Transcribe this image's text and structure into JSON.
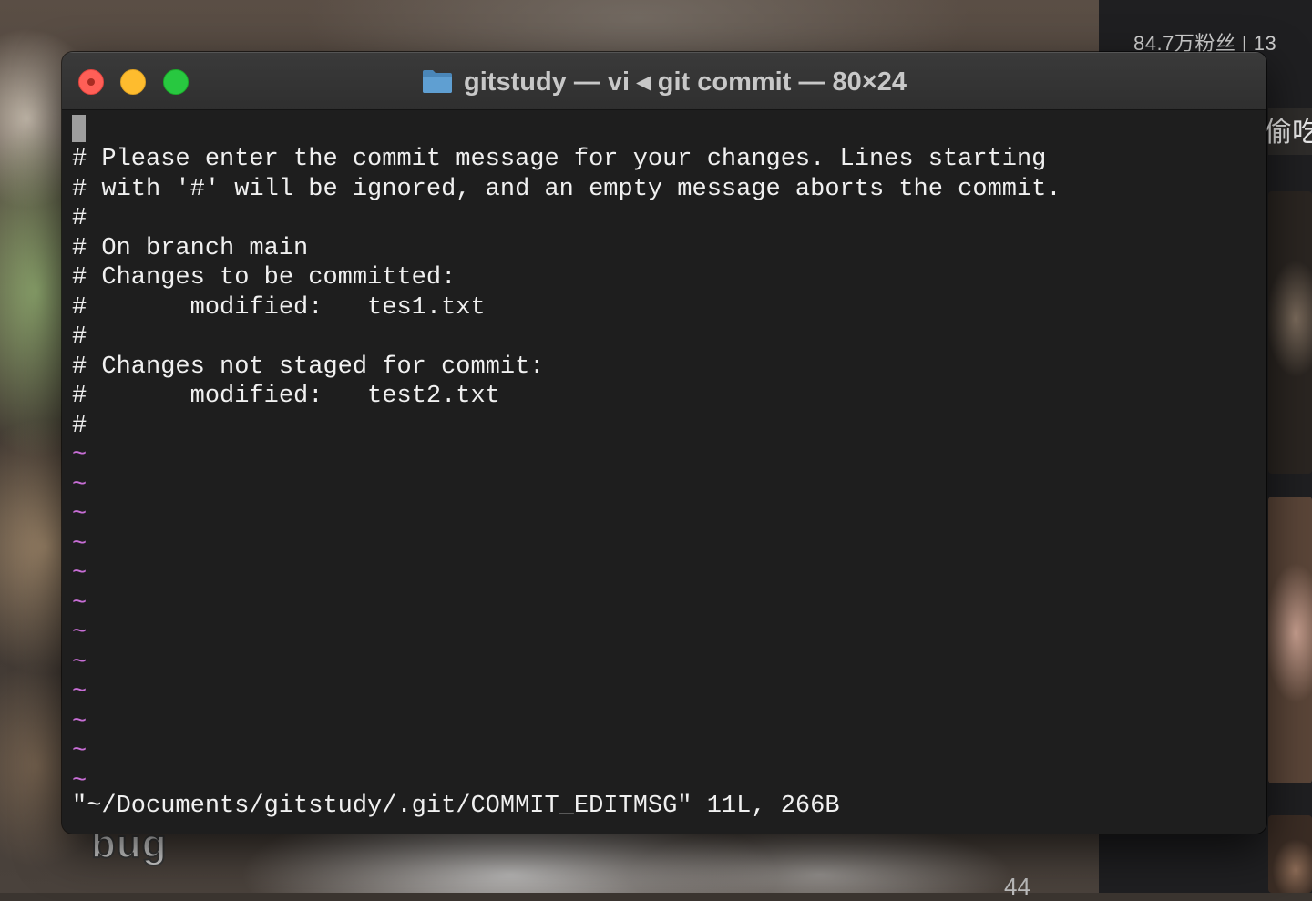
{
  "background": {
    "right_panel_top_text": "84.7万粉丝 | 13",
    "right_panel_side_text": "偷吃",
    "bottom_logo_text": "bug",
    "bottom_count_text": "44"
  },
  "window": {
    "title": "gitstudy — vi ◂ git commit — 80×24",
    "title_icon": "folder-icon",
    "traffic_lights": {
      "close_color": "#ff5f57",
      "minimize_color": "#febc2e",
      "zoom_color": "#28c840"
    }
  },
  "terminal": {
    "text_color": "#f0f0f0",
    "tilde_color": "#c86ed6",
    "background_color": "#1e1e1e",
    "lines": [
      "# Please enter the commit message for your changes. Lines starting",
      "# with '#' will be ignored, and an empty message aborts the commit.",
      "#",
      "# On branch main",
      "# Changes to be committed:",
      "#       modified:   tes1.txt",
      "#",
      "# Changes not staged for commit:",
      "#       modified:   test2.txt",
      "#"
    ],
    "empty_line_marker": "~",
    "status_line": "\"~/Documents/gitstudy/.git/COMMIT_EDITMSG\" 11L, 266B"
  }
}
